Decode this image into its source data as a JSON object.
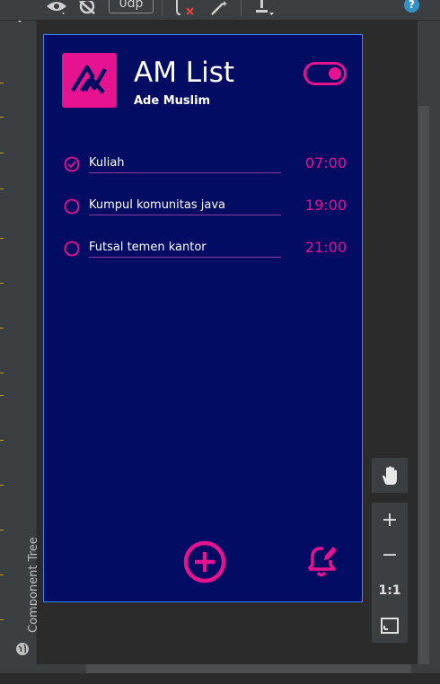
{
  "toolbar": {
    "dp_value": "0dp",
    "icons": [
      "eye-icon",
      "hide-constraints-icon",
      "clear-constraints-icon",
      "magic-wand-icon",
      "align-icon",
      "help-icon"
    ],
    "help_label": "?"
  },
  "left_panel": {
    "component_tree_label": "Component Tree"
  },
  "app": {
    "title": "AM List",
    "subtitle": "Ade Muslim",
    "logo_icon": "am-logo-icon",
    "toggle_state": "on",
    "accent_color": "#e6128f",
    "background_color": "#020c63",
    "items": [
      {
        "label": "Kuliah",
        "time": "07:00",
        "checked": true
      },
      {
        "label": "Kumpul komunitas java",
        "time": "19:00",
        "checked": false
      },
      {
        "label": "Futsal temen kantor",
        "time": "21:00",
        "checked": false
      }
    ],
    "add_button_icon": "add-circle-icon",
    "alarm_button_icon": "bell-edit-icon"
  },
  "zoom_controls": {
    "pan_icon": "hand-icon",
    "zoom_in": "+",
    "zoom_out": "−",
    "actual_size": "1:1",
    "fit_icon": "fit-screen-icon"
  }
}
